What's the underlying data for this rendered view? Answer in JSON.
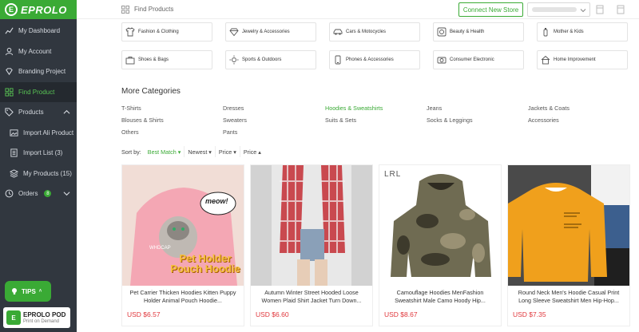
{
  "brand": {
    "logo_text": "EPROLO",
    "accent": "#3aaa35",
    "sidebar_bg": "#31373f"
  },
  "sidebar": {
    "items": [
      {
        "label": "My Dashboard",
        "icon": "chart-line-icon"
      },
      {
        "label": "My Account",
        "icon": "user-icon"
      },
      {
        "label": "Branding Project",
        "icon": "diamond-icon"
      },
      {
        "label": "Find Product",
        "icon": "grid-icon",
        "active": true
      },
      {
        "label": "Products",
        "icon": "tag-icon"
      },
      {
        "label": "Import Ali Product",
        "icon": "image-icon"
      },
      {
        "label": "Import List (3)",
        "icon": "list-icon"
      },
      {
        "label": "My Products (15)",
        "icon": "stack-icon"
      },
      {
        "label": "Orders",
        "icon": "clock-icon",
        "badge": "8"
      }
    ],
    "tips_label": "TIPS",
    "pod_title": "EPROLO POD",
    "pod_subtitle": "Print on Demand"
  },
  "topbar": {
    "title": "Find Products",
    "connect_label": "Connect New Store"
  },
  "categories": [
    {
      "label": "Fashion & Clothing",
      "icon": "shirt-icon"
    },
    {
      "label": "Jewelry & Accessories",
      "icon": "gem-icon"
    },
    {
      "label": "Cars & Motocycles",
      "icon": "car-icon"
    },
    {
      "label": "Beauty & Health",
      "icon": "beauty-icon"
    },
    {
      "label": "Mother & Kids",
      "icon": "bottle-icon"
    },
    {
      "label": "Shoes & Bags",
      "icon": "bag-icon"
    },
    {
      "label": "Sports & Outdoors",
      "icon": "sun-icon"
    },
    {
      "label": "Phones & Accessories",
      "icon": "phone-icon"
    },
    {
      "label": "Consumer Electronic",
      "icon": "camera-icon"
    },
    {
      "label": "Home Improvement",
      "icon": "house-icon"
    }
  ],
  "more_categories": {
    "title": "More Categories",
    "links": [
      "T-Shirts",
      "Dresses",
      "Hoodies & Sweatshirts",
      "Jeans",
      "Jackets & Coats",
      "Blouses & Shirts",
      "Sweaters",
      "Suits & Sets",
      "Socks & Leggings",
      "Accessories",
      "Others",
      "Pants"
    ],
    "highlighted": "Hoodies & Sweatshirts"
  },
  "sort": {
    "label": "Sort by:",
    "options": [
      "Best Match ▾",
      "Newest ▾",
      "Price ▾",
      "Price ▴"
    ],
    "active_index": 0
  },
  "products": [
    {
      "title": "Pet Carrier Thicken Hoodies Kitten Puppy Holder Animal Pouch Hoodie...",
      "price": "USD $6.57",
      "overlay": "Pet Holder Pouch Hoodie",
      "bubble": "meow!",
      "caption": "WHDCAP"
    },
    {
      "title": "Autumn Winter Street Hooded Loose Women Plaid Shirt Jacket Turn Down...",
      "price": "USD $6.60"
    },
    {
      "title": "Camouflage Hoodies MenFashion Sweatshirt Male Camo Hoody Hip...",
      "price": "USD $8.67",
      "watermark": "LRL"
    },
    {
      "title": "Round Neck Men's Hoodie Casual Print Long Sleeve Sweatshirt Men Hip-Hop...",
      "price": "USD $7.35"
    }
  ]
}
